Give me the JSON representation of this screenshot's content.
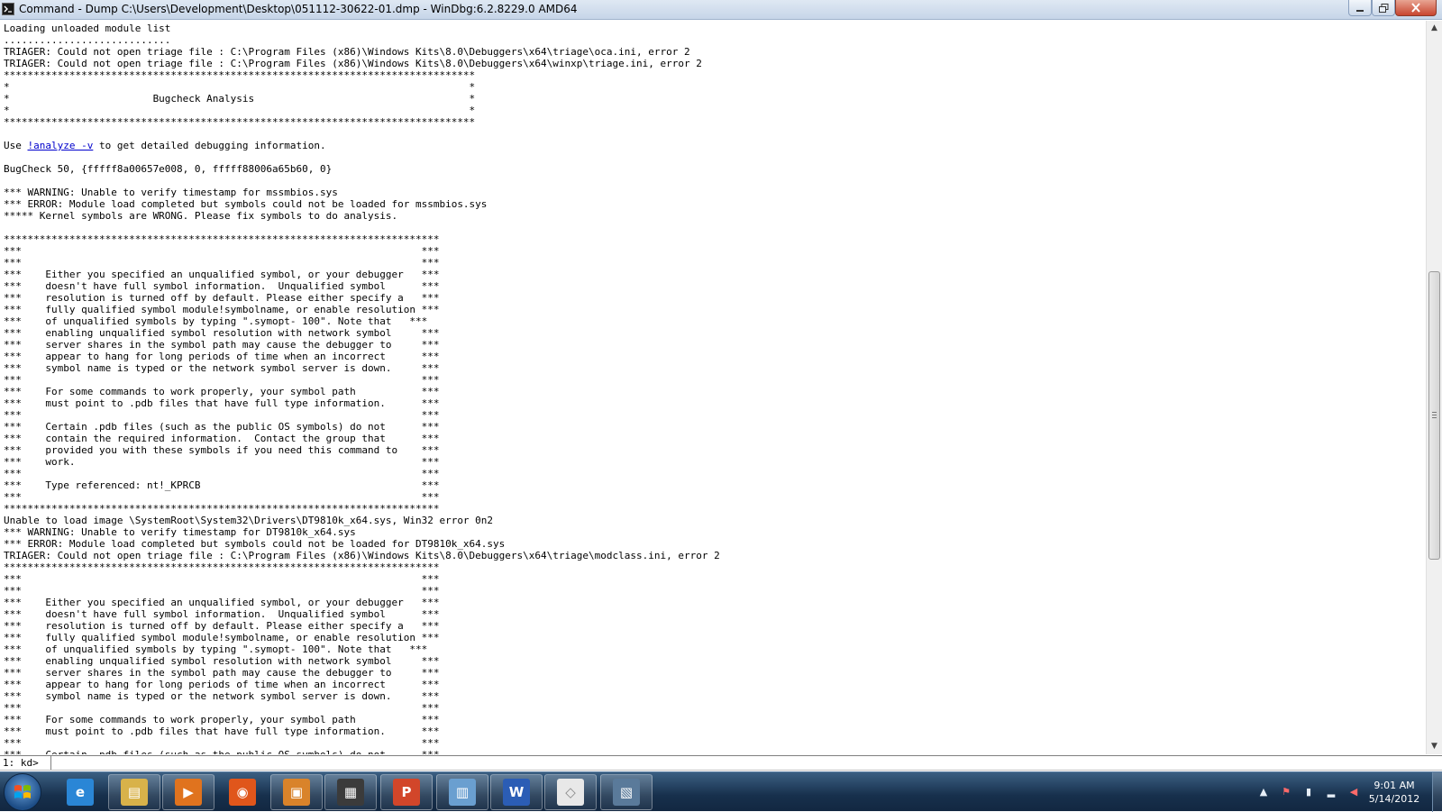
{
  "window": {
    "title": "Command - Dump C:\\Users\\Development\\Desktop\\051112-30622-01.dmp - WinDbg:6.2.8229.0 AMD64"
  },
  "console": {
    "lines_before_link": [
      "Loading unloaded module list",
      "............................",
      "TRIAGER: Could not open triage file : C:\\Program Files (x86)\\Windows Kits\\8.0\\Debuggers\\x64\\triage\\oca.ini, error 2",
      "TRIAGER: Could not open triage file : C:\\Program Files (x86)\\Windows Kits\\8.0\\Debuggers\\x64\\winxp\\triage.ini, error 2",
      "*******************************************************************************",
      "*                                                                             *",
      "*                        Bugcheck Analysis                                    *",
      "*                                                                             *",
      "*******************************************************************************",
      ""
    ],
    "link_line": {
      "prefix": "Use ",
      "link": "!analyze -v",
      "suffix": " to get detailed debugging information."
    },
    "lines_after_link": [
      "",
      "BugCheck 50, {fffff8a00657e008, 0, fffff88006a65b60, 0}",
      "",
      "*** WARNING: Unable to verify timestamp for mssmbios.sys",
      "*** ERROR: Module load completed but symbols could not be loaded for mssmbios.sys",
      "***** Kernel symbols are WRONG. Please fix symbols to do analysis.",
      "",
      "*************************************************************************",
      "***                                                                   ***",
      "***                                                                   ***",
      "***    Either you specified an unqualified symbol, or your debugger   ***",
      "***    doesn't have full symbol information.  Unqualified symbol      ***",
      "***    resolution is turned off by default. Please either specify a   ***",
      "***    fully qualified symbol module!symbolname, or enable resolution ***",
      "***    of unqualified symbols by typing \".symopt- 100\". Note that   ***",
      "***    enabling unqualified symbol resolution with network symbol     ***",
      "***    server shares in the symbol path may cause the debugger to     ***",
      "***    appear to hang for long periods of time when an incorrect      ***",
      "***    symbol name is typed or the network symbol server is down.     ***",
      "***                                                                   ***",
      "***    For some commands to work properly, your symbol path           ***",
      "***    must point to .pdb files that have full type information.      ***",
      "***                                                                   ***",
      "***    Certain .pdb files (such as the public OS symbols) do not      ***",
      "***    contain the required information.  Contact the group that      ***",
      "***    provided you with these symbols if you need this command to    ***",
      "***    work.                                                          ***",
      "***                                                                   ***",
      "***    Type referenced: nt!_KPRCB                                     ***",
      "***                                                                   ***",
      "*************************************************************************",
      "Unable to load image \\SystemRoot\\System32\\Drivers\\DT9810k_x64.sys, Win32 error 0n2",
      "*** WARNING: Unable to verify timestamp for DT9810k_x64.sys",
      "*** ERROR: Module load completed but symbols could not be loaded for DT9810k_x64.sys",
      "TRIAGER: Could not open triage file : C:\\Program Files (x86)\\Windows Kits\\8.0\\Debuggers\\x64\\triage\\modclass.ini, error 2",
      "*************************************************************************",
      "***                                                                   ***",
      "***                                                                   ***",
      "***    Either you specified an unqualified symbol, or your debugger   ***",
      "***    doesn't have full symbol information.  Unqualified symbol      ***",
      "***    resolution is turned off by default. Please either specify a   ***",
      "***    fully qualified symbol module!symbolname, or enable resolution ***",
      "***    of unqualified symbols by typing \".symopt- 100\". Note that   ***",
      "***    enabling unqualified symbol resolution with network symbol     ***",
      "***    server shares in the symbol path may cause the debugger to     ***",
      "***    appear to hang for long periods of time when an incorrect      ***",
      "***    symbol name is typed or the network symbol server is down.     ***",
      "***                                                                   ***",
      "***    For some commands to work properly, your symbol path           ***",
      "***    must point to .pdb files that have full type information.      ***",
      "***                                                                   ***",
      "***    Certain .pdb files (such as the public OS symbols) do not      ***"
    ]
  },
  "command": {
    "prompt": "1: kd>",
    "value": ""
  },
  "taskbar": {
    "items": [
      {
        "name": "internet-explorer-icon",
        "glyph": "e",
        "color": "#2a86d6"
      },
      {
        "name": "windows-explorer-icon",
        "glyph": "▤",
        "color": "#d8b24a"
      },
      {
        "name": "media-player-icon",
        "glyph": "▶",
        "color": "#e0731e"
      },
      {
        "name": "firefox-icon",
        "glyph": "◉",
        "color": "#e0561b"
      },
      {
        "name": "installer-icon",
        "glyph": "▣",
        "color": "#d9832a"
      },
      {
        "name": "movie-maker-icon",
        "glyph": "▦",
        "color": "#3b3b3b"
      },
      {
        "name": "powerpoint-icon",
        "glyph": "P",
        "color": "#d2462a"
      },
      {
        "name": "network-icon",
        "glyph": "▥",
        "color": "#6a9fd0"
      },
      {
        "name": "word-icon",
        "glyph": "W",
        "color": "#2b5db5"
      },
      {
        "name": "blank-document-icon",
        "glyph": "◇",
        "color": "#e8e8e8"
      },
      {
        "name": "windbg-icon",
        "glyph": "▧",
        "color": "#5a7a9a"
      }
    ],
    "clock_time": "9:01 AM",
    "clock_date": "5/14/2012"
  }
}
